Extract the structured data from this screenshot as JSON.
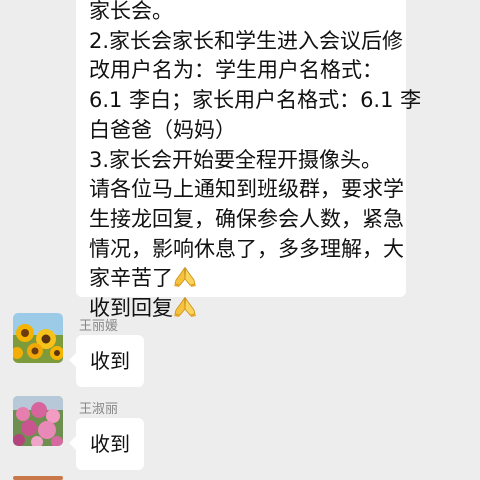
{
  "messages": [
    {
      "lines": [
        "家长会。",
        "2.家长会家长和学生进入会议后修",
        "改用户名为：学生用户名格式：",
        "6.1 李白；家长用户名格式：6.1 李",
        "白爸爸（妈妈）",
        "3.家长会开始要全程开摄像头。",
        "请各位马上通知到班级群，要求学",
        "生接龙回复，确保参会人数，紧急",
        "情况，影响休息了，多多理解，大",
        "家辛苦了",
        "收到回复"
      ],
      "emoji": "praying-hands-icon"
    },
    {
      "sender": "王丽媛",
      "text": "收到",
      "avatar": "sunflower-avatar"
    },
    {
      "sender": "王淑丽",
      "text": "收到",
      "avatar": "flowers-avatar"
    }
  ],
  "colors": {
    "background": "#ededed",
    "bubble": "#ffffff",
    "sender_name": "#888888"
  }
}
